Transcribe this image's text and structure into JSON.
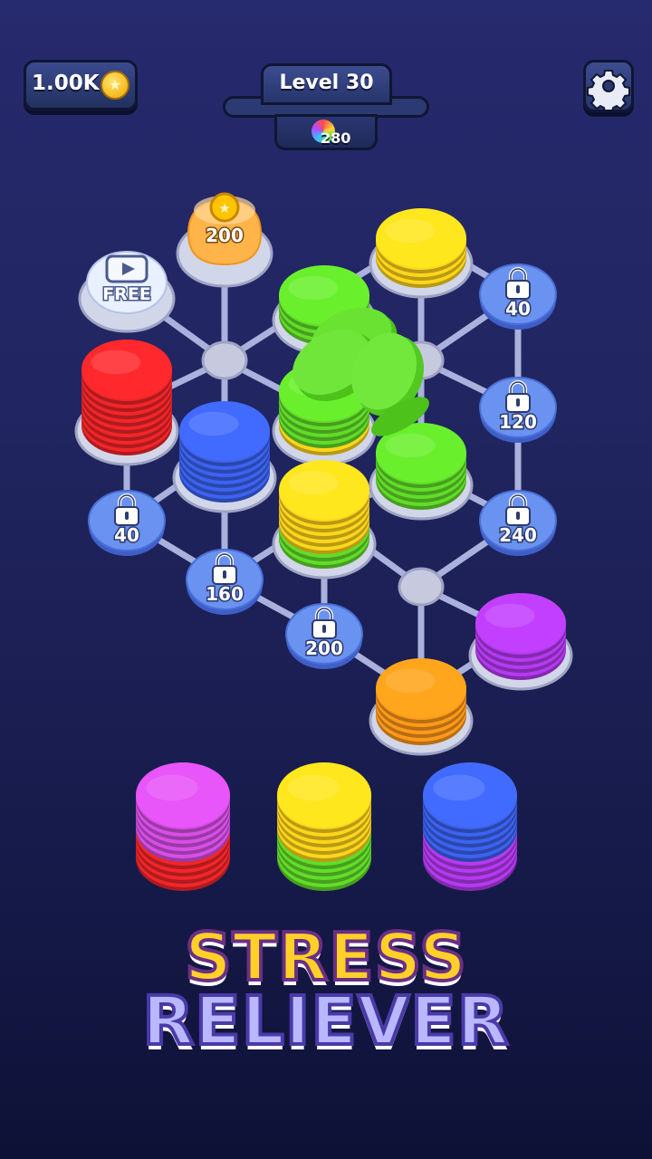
{
  "hud": {
    "coins": "1.00K",
    "level": "Level 30",
    "level_progress": 0.0,
    "gems": "280"
  },
  "board": {
    "free_label": "FREE",
    "coin_stack_cost": "200",
    "locked_costs": [
      "40",
      "120",
      "240",
      "40",
      "160",
      "200"
    ]
  },
  "colors": {
    "red": "#f2262a",
    "blue": "#3c63f0",
    "green": "#62dd2a",
    "yellow": "#ffd61c",
    "orange": "#ff9a1a",
    "purple": "#b53af0",
    "pink": "#d74fe6"
  },
  "icons": [
    "coin-icon",
    "gear-icon",
    "lock-icon",
    "video-icon",
    "gem-icon"
  ],
  "slogan": {
    "line1": "STRESS",
    "line2": "RELIEVER"
  }
}
